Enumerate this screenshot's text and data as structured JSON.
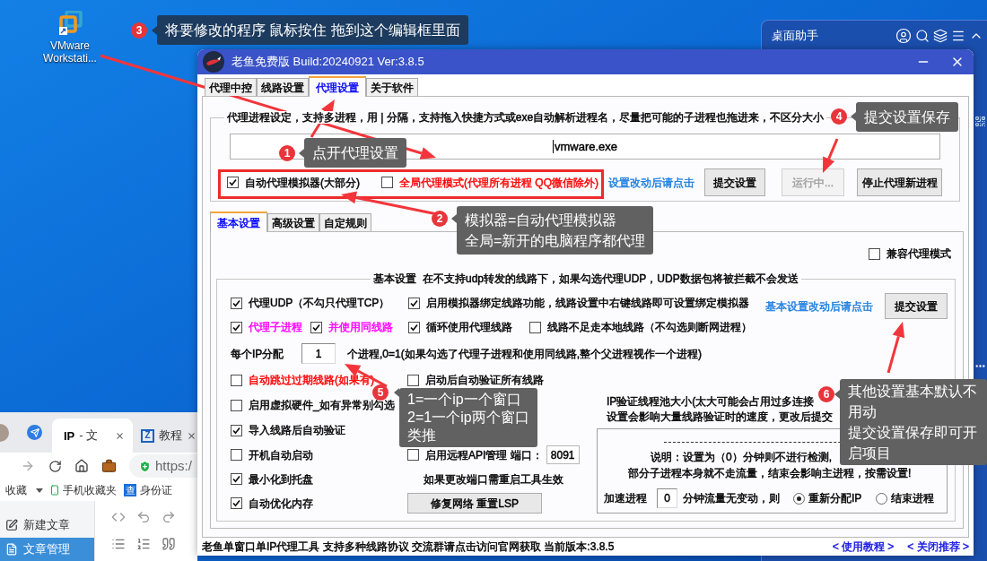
{
  "desktop_icon": {
    "label_lines": [
      "VMware",
      "Workstati..."
    ]
  },
  "helper_panel": {
    "title": "桌面助手"
  },
  "browser": {
    "tabs": [
      {
        "kind": "plain",
        "favicon": "IP",
        "label": "- 文",
        "selected": true
      },
      {
        "kind": "boxed",
        "favicon": "Z",
        "label": "教程",
        "selected": false
      }
    ],
    "address": "https:/",
    "bookmarks": [
      {
        "kind": "folder",
        "label": "收藏"
      },
      {
        "kind": "phone",
        "label": "手机收藏夹"
      },
      {
        "kind": "site",
        "favicon": "查",
        "label": "身份证"
      }
    ],
    "sidebar": [
      {
        "label": "新建文章",
        "selected": false
      },
      {
        "label": "文章管理",
        "selected": true
      }
    ]
  },
  "app_window": {
    "title": "老鱼免费版 Build:20240921 Ver:3.8.5",
    "tabs": [
      {
        "label": "代理中控",
        "selected": false
      },
      {
        "label": "线路设置",
        "selected": false
      },
      {
        "label": "代理设置",
        "selected": true
      },
      {
        "label": "关于软件",
        "selected": false
      }
    ],
    "process_group": {
      "legend": "代理进程设定，支持多进程，用 | 分隔，支持拖入快捷方式或exe自动解析进程名，尽量把可能的子进程也拖进来，不区分大小",
      "process_field": {
        "value": "vmware.exe"
      },
      "options": [
        {
          "label": "自动代理模拟器(大部分)",
          "checked": true,
          "color": "#000000"
        },
        {
          "label": "全局代理模式(代理所有进程 QQ微信除外)",
          "checked": false,
          "color": "#ff0000"
        }
      ],
      "hint_link": "设置改动后请点击",
      "buttons": [
        {
          "label": "提交设置",
          "disabled": false
        },
        {
          "label": "运行中...",
          "disabled": true
        },
        {
          "label": "停止代理新进程",
          "disabled": false
        }
      ]
    },
    "sub_tabs": [
      {
        "label": "基本设置",
        "selected": true
      },
      {
        "label": "高级设置",
        "selected": false
      },
      {
        "label": "自定规则",
        "selected": false
      }
    ],
    "compat_mode": {
      "label": "兼容代理模式",
      "checked": false
    },
    "basic_group": {
      "legend": "基本设置  在不支持udp转发的线路下，如果勾选代理UDP，UDP数据包将被拦截不会发送",
      "top_rows": [
        {
          "left": [
            {
              "label": "代理UDP（不勾只代理TCP）",
              "checked": true,
              "color": "#000000"
            }
          ],
          "right": [
            {
              "label": "启用模拟器绑定线路功能，线路设置中右键线路即可设置绑定模拟器",
              "checked": true,
              "color": "#000000"
            }
          ]
        },
        {
          "left": [
            {
              "label": "代理子进程",
              "checked": true,
              "color": "#ff00ff"
            },
            {
              "label": "并使用同线路",
              "checked": true,
              "color": "#ff00ff"
            }
          ],
          "right": [
            {
              "label": "循环使用代理线路",
              "checked": true,
              "color": "#000000"
            },
            {
              "label": "线路不足走本地线路（不勾选则断网进程）",
              "checked": false,
              "color": "#000000"
            }
          ]
        }
      ],
      "hint_link": "基本设置改动后请点击",
      "submit_button": "提交设置",
      "ip_alloc": {
        "label": "每个IP分配",
        "value": "1",
        "note": "个进程,0=1(如果勾选了代理子进程和使用同线路,整个父进程视作一个进程)"
      },
      "left_options": [
        {
          "label": "自动跳过过期线路(如果有)",
          "checked": false,
          "color": "#ff0000"
        },
        {
          "label": "启用虚拟硬件_如有异常别勾选",
          "checked": false,
          "color": "#000000"
        },
        {
          "label": "导入线路后自动验证",
          "checked": true,
          "color": "#000000"
        },
        {
          "label": "开机自动启动",
          "checked": false,
          "color": "#000000"
        },
        {
          "label": "最小化到托盘",
          "checked": true,
          "color": "#000000"
        },
        {
          "label": "自动优化内存",
          "checked": true,
          "color": "#000000"
        }
      ],
      "auto_verify": {
        "label": "启动后自动验证所有线路",
        "checked": false
      },
      "remote_api": {
        "label": "启用远程API管理 端口：",
        "checked": false,
        "port": "8091",
        "note": "如果更改端口需重启工具生效"
      },
      "repair_button": "修复网络 重置LSP",
      "pool_lines": [
        "IP验证线程池大小(太大可能会占用过多连接",
        "设置会影响大量线路验证时的速度，更改后提交"
      ],
      "notice_lines": [
        "说明：设置为（0）分钟则不进行检测,",
        "部分子进程本身就不走流量，结束会影响主进程，按需设置!"
      ],
      "speedup": {
        "label": "加速进程",
        "value": "0",
        "unit": "分钟流量无变动，则",
        "choices": [
          {
            "label": "重新分配IP",
            "selected": true
          },
          {
            "label": "结束进程",
            "selected": false
          }
        ]
      }
    },
    "status": {
      "text": "老鱼单窗口单IP代理工具 支持多种线路协议 交流群请点击访问官网获取 当前版本:3.8.5",
      "links": [
        "< 使用教程 >",
        "< 关闭推荐 >"
      ]
    }
  },
  "callouts": [
    {
      "number": "1",
      "lines": [
        "点开代理设置"
      ],
      "color": "#616161"
    },
    {
      "number": "2",
      "lines": [
        "模拟器=自动代理模拟器",
        "全局=新开的电脑程序都代理"
      ],
      "color": "#616161"
    },
    {
      "number": "3",
      "lines": [
        "将要修改的程序 鼠标按住 拖到这个编辑框里面"
      ],
      "color": "#1c3b5e"
    },
    {
      "number": "4",
      "lines": [
        "提交设置保存"
      ],
      "color": "#616161"
    },
    {
      "number": "5",
      "lines": [
        "1=一个ip一个窗口",
        "2=1一个ip两个窗口",
        "类推"
      ],
      "color": "#616161"
    },
    {
      "number": "6",
      "lines": [
        "其他设置基本默认不",
        "用动",
        "提交设置保存即可开",
        "启项目"
      ],
      "color": "#616161"
    }
  ]
}
